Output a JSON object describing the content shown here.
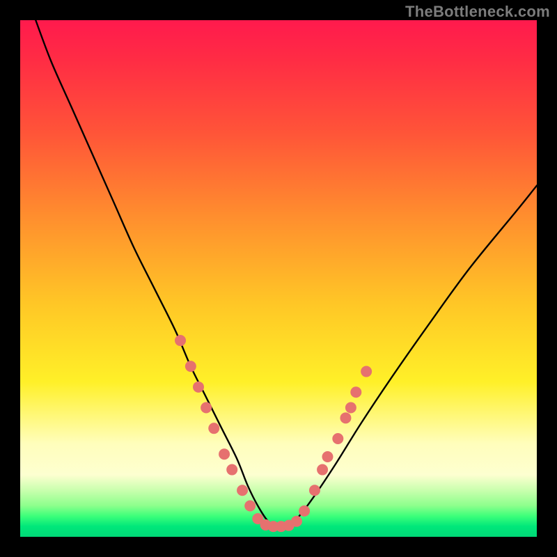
{
  "watermark": "TheBottleneck.com",
  "chart_data": {
    "type": "line",
    "title": "",
    "xlabel": "",
    "ylabel": "",
    "xlim": [
      0,
      100
    ],
    "ylim": [
      0,
      100
    ],
    "series": [
      {
        "name": "bottleneck-curve",
        "x": [
          3,
          6,
          10,
          14,
          18,
          22,
          26,
          30,
          33,
          36,
          39,
          42,
          44,
          46,
          48,
          50,
          52,
          54,
          57,
          61,
          66,
          72,
          79,
          87,
          96,
          100
        ],
        "y": [
          100,
          92,
          83,
          74,
          65,
          56,
          48,
          40,
          33,
          27,
          21,
          15,
          10,
          6,
          3,
          2,
          2,
          4,
          8,
          14,
          22,
          31,
          41,
          52,
          63,
          68
        ]
      }
    ],
    "markers": {
      "name": "highlight-dots",
      "color": "#e6716f",
      "radius": 8,
      "points": [
        {
          "x": 31,
          "y": 38
        },
        {
          "x": 33,
          "y": 33
        },
        {
          "x": 34.5,
          "y": 29
        },
        {
          "x": 36,
          "y": 25
        },
        {
          "x": 37.5,
          "y": 21
        },
        {
          "x": 39.5,
          "y": 16
        },
        {
          "x": 41,
          "y": 13
        },
        {
          "x": 43,
          "y": 9
        },
        {
          "x": 44.5,
          "y": 6
        },
        {
          "x": 46,
          "y": 3.5
        },
        {
          "x": 47.5,
          "y": 2.3
        },
        {
          "x": 49,
          "y": 2
        },
        {
          "x": 50.5,
          "y": 2
        },
        {
          "x": 52,
          "y": 2.2
        },
        {
          "x": 53.5,
          "y": 3
        },
        {
          "x": 55,
          "y": 5
        },
        {
          "x": 57,
          "y": 9
        },
        {
          "x": 58.5,
          "y": 13
        },
        {
          "x": 59.5,
          "y": 15.5
        },
        {
          "x": 61.5,
          "y": 19
        },
        {
          "x": 63,
          "y": 23
        },
        {
          "x": 64,
          "y": 25
        },
        {
          "x": 65,
          "y": 28
        },
        {
          "x": 67,
          "y": 32
        }
      ]
    }
  }
}
